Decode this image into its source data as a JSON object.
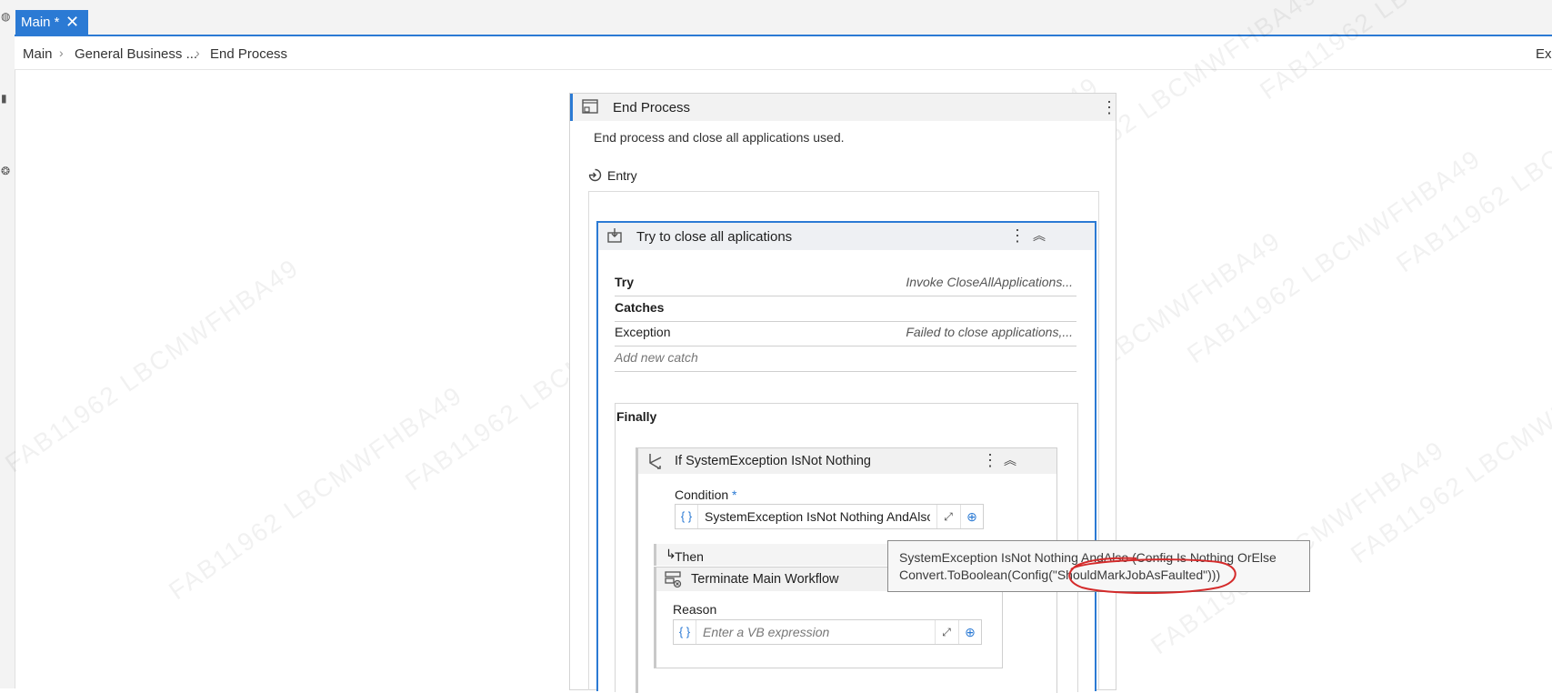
{
  "tab": {
    "label": "Main *",
    "close_glyph": "✕"
  },
  "breadcrumb": {
    "items": [
      "Main",
      "General Business ...",
      "End Process"
    ],
    "right_cutoff_text": "Exp"
  },
  "watermark_text": "FAB11962 LBCMWFHBA49",
  "process": {
    "title": "End Process",
    "description": "End process and close all applications used.",
    "entry_label": "Entry",
    "icon": "sequence-icon"
  },
  "try_catch": {
    "title": "Try to close all aplications",
    "try_label": "Try",
    "try_value": "Invoke CloseAllApplications...",
    "catches_label": "Catches",
    "exception_label": "Exception",
    "exception_value": "Failed to close applications,...",
    "add_catch": "Add new catch",
    "finally_label": "Finally"
  },
  "if_activity": {
    "title": "If SystemException IsNot Nothing",
    "condition_label": "Condition",
    "required_marker": "*",
    "condition_value": "SystemException IsNot Nothing AndAlso (",
    "then_label": "Then"
  },
  "terminate": {
    "title": "Terminate Main Workflow",
    "reason_label": "Reason",
    "reason_placeholder": "Enter a VB expression"
  },
  "tooltip": {
    "line1": "SystemException IsNot Nothing AndAlso (Config Is Nothing OrElse",
    "line2": "Convert.ToBoolean(Config(\"ShouldMarkJobAsFaulted\")))"
  },
  "expr_brace": "{ }",
  "colors": {
    "accent": "#2b7ad4",
    "annotation": "#d42a2a"
  }
}
